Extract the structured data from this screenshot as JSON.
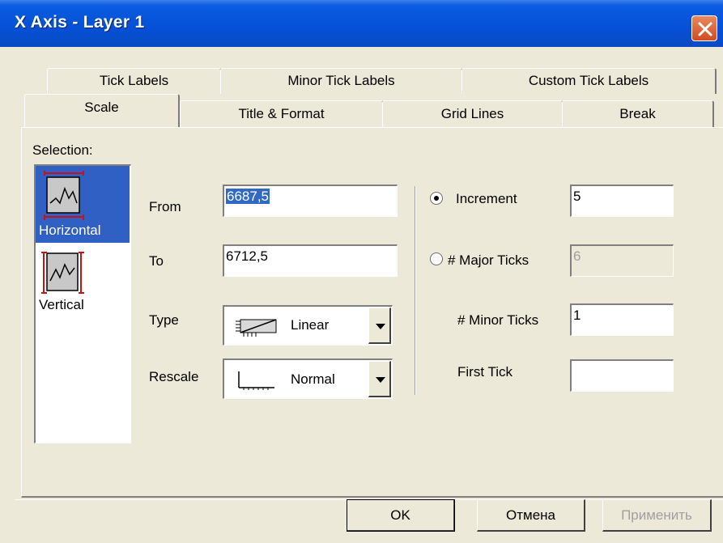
{
  "window": {
    "title": "X Axis - Layer 1"
  },
  "tabs": {
    "row1": [
      "Tick Labels",
      "Minor Tick Labels",
      "Custom Tick Labels"
    ],
    "row2": [
      "Scale",
      "Title & Format",
      "Grid Lines",
      "Break"
    ],
    "active": "Scale"
  },
  "selection": {
    "label": "Selection:",
    "items": [
      {
        "label": "Horizontal",
        "icon": "horizontal-axis-icon",
        "selected": true
      },
      {
        "label": "Vertical",
        "icon": "vertical-axis-icon",
        "selected": false
      }
    ]
  },
  "scale": {
    "from_label": "From",
    "from_value": "6687,5",
    "to_label": "To",
    "to_value": "6712,5",
    "type_label": "Type",
    "type_value": "Linear",
    "rescale_label": "Rescale",
    "rescale_value": "Normal"
  },
  "ticks": {
    "increment_label": "Increment",
    "increment_value": "5",
    "increment_checked": true,
    "major_label": "# Major Ticks",
    "major_value": "6",
    "major_checked": false,
    "minor_label": "# Minor Ticks",
    "minor_value": "1",
    "first_tick_label": "First Tick",
    "first_tick_value": ""
  },
  "buttons": {
    "ok": "OK",
    "cancel": "Отмена",
    "apply": "Применить"
  },
  "colors": {
    "titlebar": "#0550d6",
    "selection_highlight": "#3160c4",
    "close_button": "#d24b22",
    "face": "#ece9d8"
  }
}
